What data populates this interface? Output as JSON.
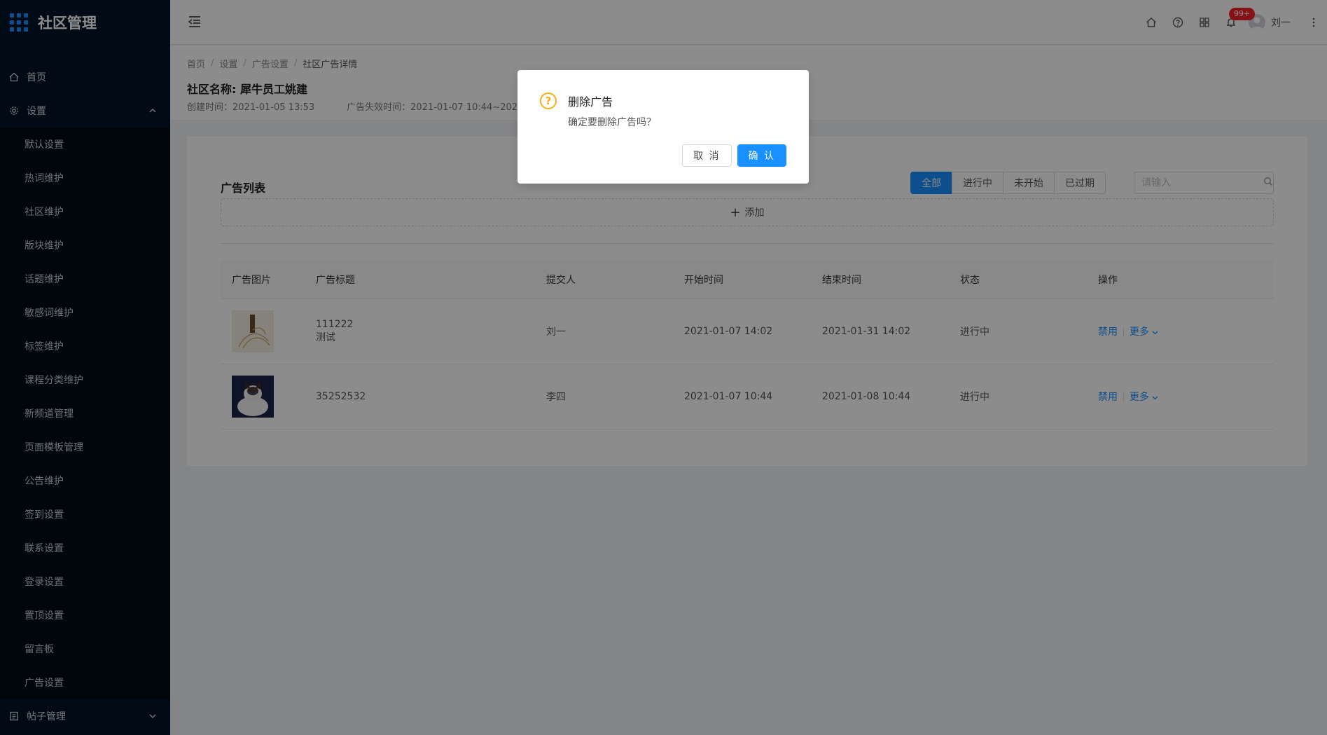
{
  "app": {
    "title": "社区管理"
  },
  "sidebar": {
    "home": "首页",
    "settings": "设置",
    "settings_items": [
      "默认设置",
      "热词维护",
      "社区维护",
      "版块维护",
      "话题维护",
      "敏感词维护",
      "标签维护",
      "课程分类维护",
      "新频道管理",
      "页面模板管理",
      "公告维护",
      "签到设置",
      "联系设置",
      "登录设置",
      "置顶设置",
      "留言板",
      "广告设置"
    ],
    "posts": "帖子管理"
  },
  "header": {
    "badge": "99+",
    "user_name": "刘一"
  },
  "breadcrumb": [
    "首页",
    "设置",
    "广告设置",
    "社区广告详情"
  ],
  "community": {
    "name": "社区名称: 犀牛员工姚建",
    "created": "创建时间：2021-01-05 13:53",
    "ad_expire": "广告失效时间：2021-01-07 10:44~2021"
  },
  "ad_list": {
    "title": "广告列表",
    "filters": [
      "全部",
      "进行中",
      "未开始",
      "已过期"
    ],
    "active_filter": "全部",
    "search_placeholder": "请输入",
    "add_label": "添加",
    "columns": [
      "广告图片",
      "广告标题",
      "提交人",
      "开始时间",
      "结束时间",
      "状态",
      "操作"
    ],
    "rows": [
      {
        "title_line1": "111222",
        "title_line2": "测试",
        "submitter": "刘一",
        "start": "2021-01-07 14:02",
        "end": "2021-01-31 14:02",
        "status": "进行中",
        "op_disable": "禁用",
        "op_more": "更多"
      },
      {
        "title_line1": "35252532",
        "title_line2": "",
        "submitter": "李四",
        "start": "2021-01-07 10:44",
        "end": "2021-01-08 10:44",
        "status": "进行中",
        "op_disable": "禁用",
        "op_more": "更多"
      }
    ]
  },
  "modal": {
    "title": "删除广告",
    "content": "确定要删除广告吗？",
    "cancel": "取 消",
    "ok": "确 认"
  },
  "colors": {
    "primary": "#1890ff",
    "sidebar_bg": "#001529",
    "warning": "#faad14",
    "badge": "#f5222d"
  }
}
